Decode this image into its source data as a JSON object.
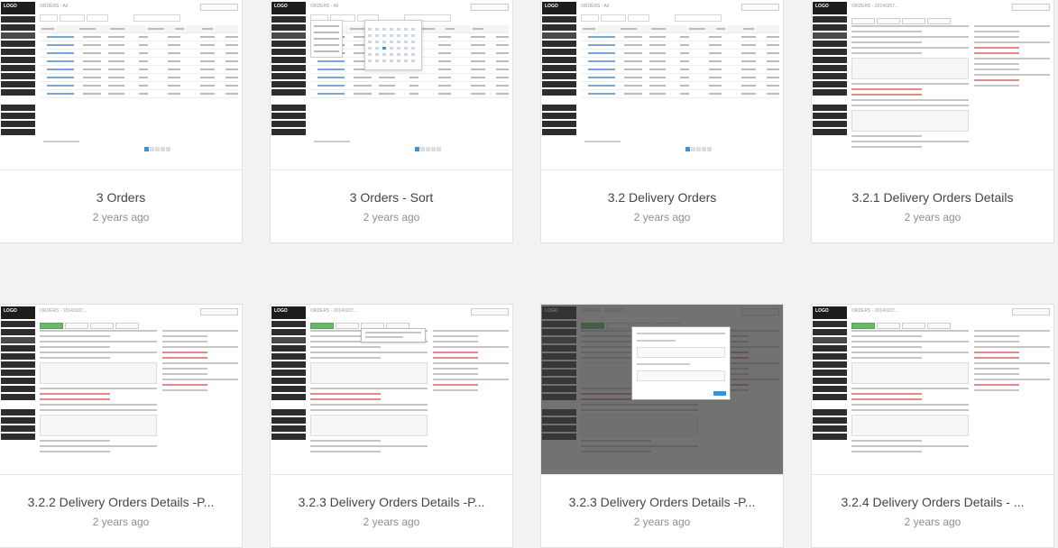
{
  "cards": [
    {
      "title": "3 Orders",
      "date": "2 years ago",
      "thumb": "orders-list"
    },
    {
      "title": "3 Orders - Sort",
      "date": "2 years ago",
      "thumb": "orders-sort"
    },
    {
      "title": "3.2 Delivery Orders",
      "date": "2 years ago",
      "thumb": "orders-list"
    },
    {
      "title": "3.2.1 Delivery Orders Details",
      "date": "2 years ago",
      "thumb": "details"
    },
    {
      "title": "3.2.2 Delivery Orders Details -P...",
      "date": "2 years ago",
      "thumb": "details-progress"
    },
    {
      "title": "3.2.3 Delivery Orders Details -P...",
      "date": "2 years ago",
      "thumb": "details-tooltip"
    },
    {
      "title": "3.2.3 Delivery Orders Details -P...",
      "date": "2 years ago",
      "thumb": "details-modal"
    },
    {
      "title": "3.2.4 Delivery Orders Details - ...",
      "date": "2 years ago",
      "thumb": "details-progress"
    }
  ],
  "thumb_text": {
    "logo": "LOGO",
    "orders_title": "ORDERS - All",
    "delivery_title": "ORDERS - Delivery",
    "detail_title": "ORDERS - 20140207..."
  },
  "colors": {
    "sidebar": "#2d2d2d",
    "accent_blue": "#3d8fd6",
    "progress_green": "#6cb86a",
    "alert_red": "#e08a8a"
  }
}
